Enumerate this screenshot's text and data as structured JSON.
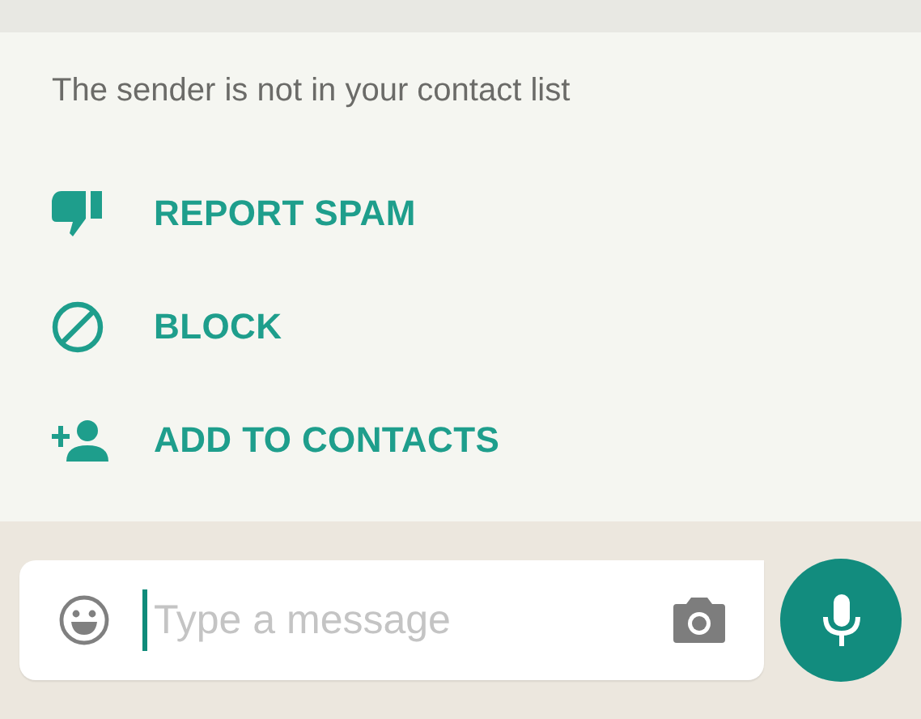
{
  "notice": {
    "text": "The sender is not in your contact list"
  },
  "actions": [
    {
      "kind": "spam",
      "label": "REPORT SPAM"
    },
    {
      "kind": "block",
      "label": "BLOCK"
    },
    {
      "kind": "add",
      "label": "ADD TO CONTACTS"
    }
  ],
  "composer": {
    "placeholder": "Type a message",
    "focused": true
  }
}
